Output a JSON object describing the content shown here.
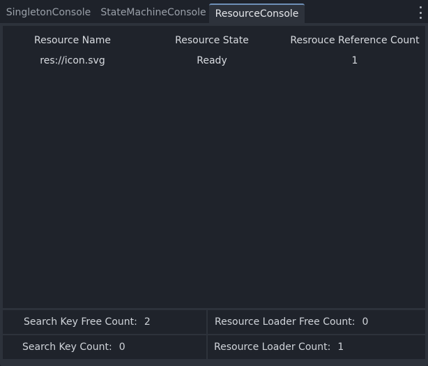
{
  "tabs": [
    "SingletonConsole",
    "StateMachineConsole",
    "ResourceConsole"
  ],
  "active_tab": "ResourceConsole",
  "table": {
    "columns": [
      "Resource Name",
      "Resource State",
      "Resrouce Reference Count"
    ],
    "rows": [
      [
        "res://icon.svg",
        "Ready",
        "1"
      ]
    ]
  },
  "stats": {
    "search_key_free_count": {
      "label": "Search Key Free Count:",
      "value": "2"
    },
    "resource_loader_free_count": {
      "label": "Resource Loader Free Count:",
      "value": "0"
    },
    "search_key_count": {
      "label": "Search Key Count:",
      "value": "0"
    },
    "resource_loader_count": {
      "label": "Resource Loader Count:",
      "value": "1"
    }
  },
  "colors": {
    "background": "#1e222a",
    "panel": "#2d323b",
    "table_bg": "#1f232b",
    "active_tab_accent": "#6f90b8"
  }
}
